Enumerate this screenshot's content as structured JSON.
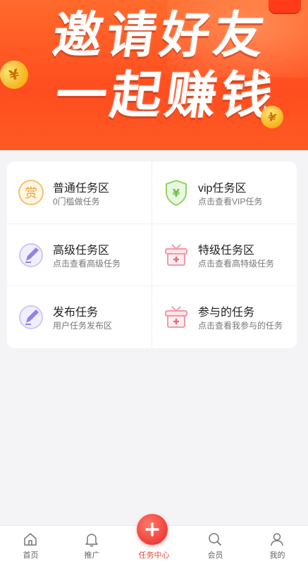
{
  "banner": {
    "line1": "邀请好友",
    "line2": "一起赚钱",
    "coin_symbol": "¥"
  },
  "tasks": [
    {
      "title": "普通任务区",
      "subtitle": "0门槛做任务",
      "icon": "reward-icon",
      "color": "#f5a623"
    },
    {
      "title": "vip任务区",
      "subtitle": "点击查看VIP任务",
      "icon": "vip-shield-icon",
      "color": "#7fcf5a"
    },
    {
      "title": "高级任务区",
      "subtitle": "点击查看高级任务",
      "icon": "pen-icon",
      "color": "#8f84e8"
    },
    {
      "title": "特级任务区",
      "subtitle": "点击查看高特级任务",
      "icon": "gift-box-icon",
      "color": "#f07a8a"
    },
    {
      "title": "发布任务",
      "subtitle": "用户任务发布区",
      "icon": "pen-icon",
      "color": "#8f84e8"
    },
    {
      "title": "参与的任务",
      "subtitle": "点击查看我参与的任务",
      "icon": "gift-box-icon",
      "color": "#f07a8a"
    }
  ],
  "tabbar": {
    "items": [
      {
        "label": "首页",
        "icon": "home-icon"
      },
      {
        "label": "推广",
        "icon": "bell-icon"
      },
      {
        "label": "任务中心",
        "icon": "plus-icon",
        "active": true
      },
      {
        "label": "会员",
        "icon": "search-icon"
      },
      {
        "label": "我的",
        "icon": "user-icon"
      }
    ],
    "active_color": "#e8453c"
  },
  "reward_glyph": "赏",
  "yen_glyph": "¥"
}
